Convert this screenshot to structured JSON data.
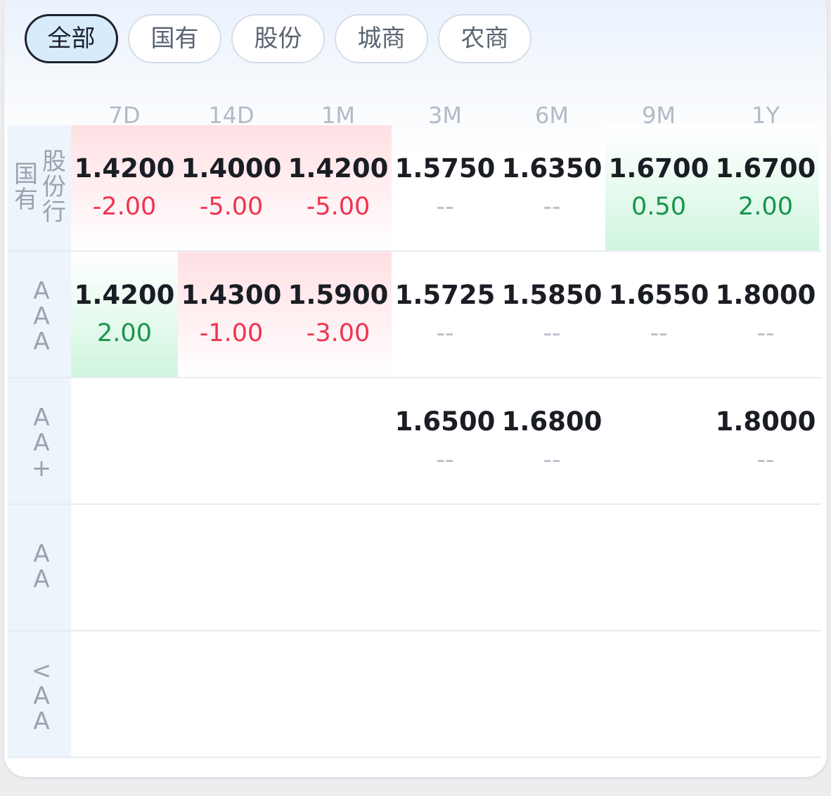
{
  "filters": [
    {
      "label": "全部",
      "active": true
    },
    {
      "label": "国有",
      "active": false
    },
    {
      "label": "股份",
      "active": false
    },
    {
      "label": "城商",
      "active": false
    },
    {
      "label": "农商",
      "active": false
    }
  ],
  "columns": [
    "7D",
    "14D",
    "1M",
    "3M",
    "6M",
    "9M",
    "1Y"
  ],
  "rows": [
    {
      "label_cols": [
        [
          "国",
          "有"
        ],
        [
          "股",
          "份",
          "行"
        ]
      ],
      "cells": [
        {
          "rate": "1.4200",
          "change": "-2.00",
          "trend": "down"
        },
        {
          "rate": "1.4000",
          "change": "-5.00",
          "trend": "down"
        },
        {
          "rate": "1.4200",
          "change": "-5.00",
          "trend": "down"
        },
        {
          "rate": "1.5750",
          "change": "--",
          "trend": "flat"
        },
        {
          "rate": "1.6350",
          "change": "--",
          "trend": "flat"
        },
        {
          "rate": "1.6700",
          "change": "0.50",
          "trend": "up"
        },
        {
          "rate": "1.6700",
          "change": "2.00",
          "trend": "up"
        }
      ]
    },
    {
      "label_cols": [
        [
          "A",
          "A",
          "A"
        ]
      ],
      "cells": [
        {
          "rate": "1.4200",
          "change": "2.00",
          "trend": "up"
        },
        {
          "rate": "1.4300",
          "change": "-1.00",
          "trend": "down"
        },
        {
          "rate": "1.5900",
          "change": "-3.00",
          "trend": "down"
        },
        {
          "rate": "1.5725",
          "change": "--",
          "trend": "flat"
        },
        {
          "rate": "1.5850",
          "change": "--",
          "trend": "flat"
        },
        {
          "rate": "1.6550",
          "change": "--",
          "trend": "flat"
        },
        {
          "rate": "1.8000",
          "change": "--",
          "trend": "flat"
        }
      ]
    },
    {
      "label_cols": [
        [
          "A",
          "A",
          "+"
        ]
      ],
      "cells": [
        null,
        null,
        null,
        {
          "rate": "1.6500",
          "change": "--",
          "trend": "flat"
        },
        {
          "rate": "1.6800",
          "change": "--",
          "trend": "flat"
        },
        null,
        {
          "rate": "1.8000",
          "change": "--",
          "trend": "flat"
        }
      ]
    },
    {
      "label_cols": [
        [
          "A",
          "A"
        ]
      ],
      "cells": [
        null,
        null,
        null,
        null,
        null,
        null,
        null
      ]
    },
    {
      "label_cols": [
        [
          "<",
          "A",
          "A"
        ]
      ],
      "cells": [
        null,
        null,
        null,
        null,
        null,
        null,
        null
      ]
    }
  ]
}
